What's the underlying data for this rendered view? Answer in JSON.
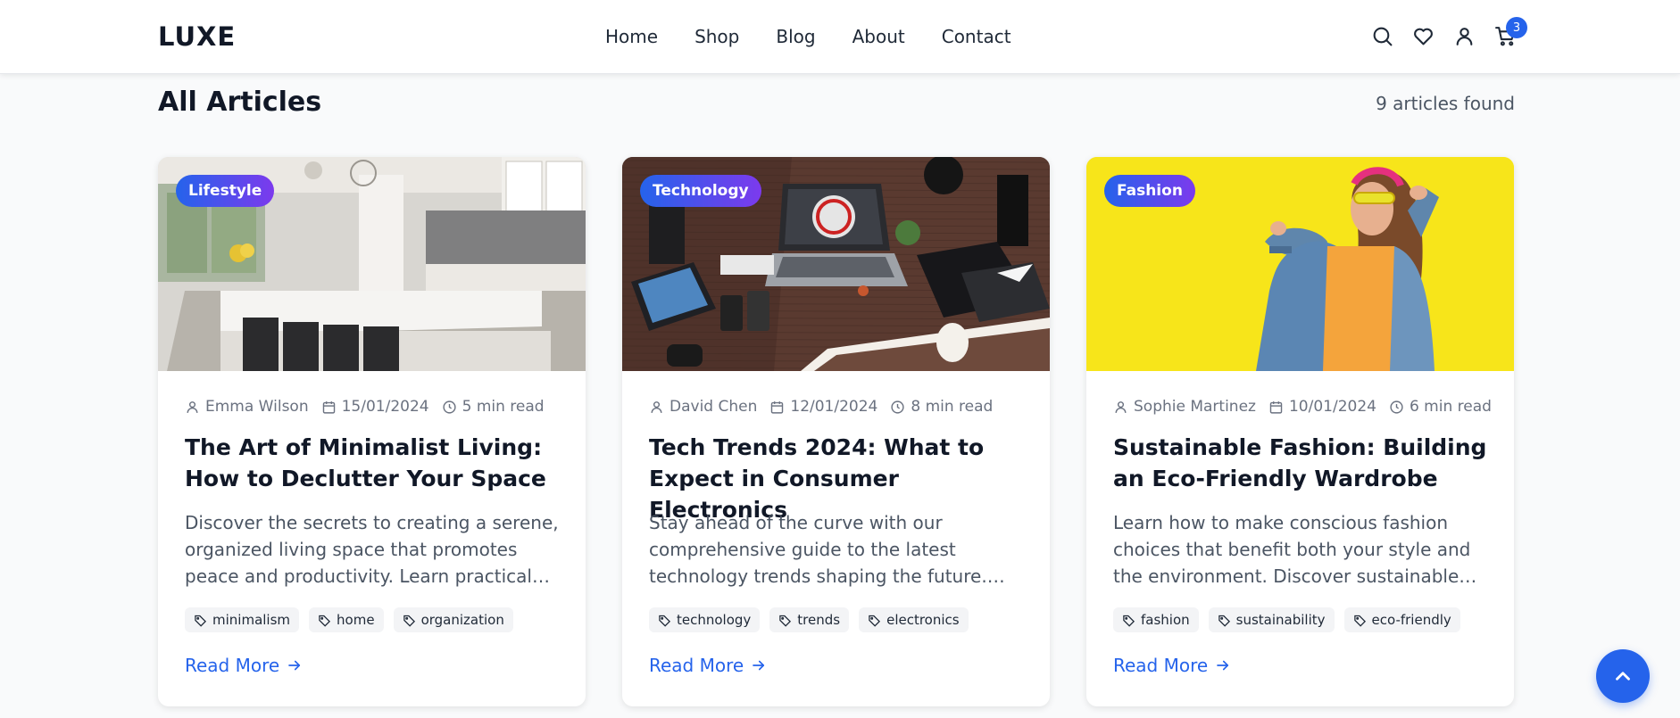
{
  "header": {
    "logo": "LUXE",
    "nav": [
      "Home",
      "Shop",
      "Blog",
      "About",
      "Contact"
    ],
    "cart_count": "3"
  },
  "section": {
    "title": "All Articles",
    "count": "9 articles found"
  },
  "articles": [
    {
      "category": "Lifestyle",
      "author": "Emma Wilson",
      "date": "15/01/2024",
      "read_time": "5 min read",
      "title": "The Art of Minimalist Living: How to Declutter Your Space",
      "excerpt": "Discover the secrets to creating a serene, organized living space that promotes peace and productivity. Learn practical tips for…",
      "tags": [
        "minimalism",
        "home",
        "organization"
      ],
      "read_more": "Read More"
    },
    {
      "category": "Technology",
      "author": "David Chen",
      "date": "12/01/2024",
      "read_time": "8 min read",
      "title": "Tech Trends 2024: What to Expect in Consumer Electronics",
      "excerpt": "Stay ahead of the curve with our comprehensive guide to the latest technology trends shaping the future. From AI integrati…",
      "tags": [
        "technology",
        "trends",
        "electronics"
      ],
      "read_more": "Read More"
    },
    {
      "category": "Fashion",
      "author": "Sophie Martinez",
      "date": "10/01/2024",
      "read_time": "6 min read",
      "title": "Sustainable Fashion: Building an Eco-Friendly Wardrobe",
      "excerpt": "Learn how to make conscious fashion choices that benefit both your style and the environment. Discover sustainable brands a…",
      "tags": [
        "fashion",
        "sustainability",
        "eco-friendly"
      ],
      "read_more": "Read More"
    }
  ],
  "colors": {
    "accent": "#2563eb",
    "badge_gradient_end": "#7c3aed"
  }
}
